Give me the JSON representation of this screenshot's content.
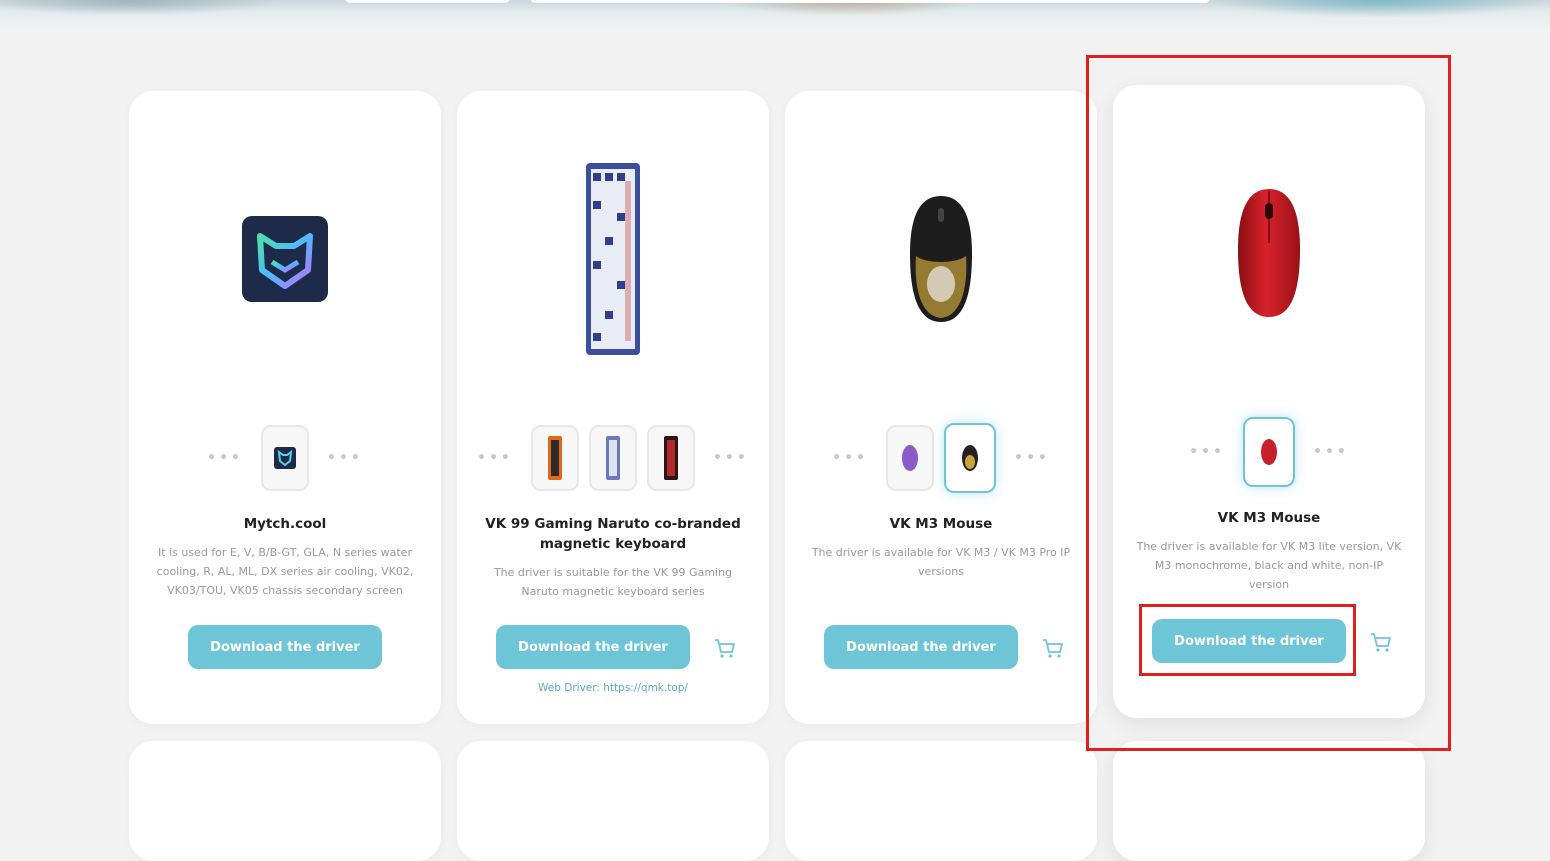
{
  "cards": [
    {
      "title": "Mytch.cool",
      "description": "It is used for E, V, B/B-GT, GLA, N series water cooling, R, AL, ML, DX series air cooling, VK02, VK03/TOU, VK05 chassis secondary screen",
      "button": "Download the driver",
      "icon": "mytch-logo-icon"
    },
    {
      "title": "VK 99 Gaming Naruto co-branded magnetic keyboard",
      "description": "The driver is suitable for the VK 99 Gaming Naruto magnetic keyboard series",
      "button": "Download the driver",
      "web_driver": "Web Driver: https://qmk.top/",
      "icon": "keyboard-icon"
    },
    {
      "title": "VK M3 Mouse",
      "description": "The driver is available for VK M3 / VK M3 Pro IP versions",
      "button": "Download the driver",
      "icon": "mouse-icon"
    },
    {
      "title": "VK M3 Mouse",
      "description": "The driver is available for VK M3 lite version, VK M3 monochrome, black and white, non-IP version",
      "button": "Download the driver",
      "icon": "red-mouse-icon"
    }
  ],
  "colors": {
    "accent": "#6fc5d8",
    "highlight": "#e02020",
    "background": "#f2f2f2"
  }
}
